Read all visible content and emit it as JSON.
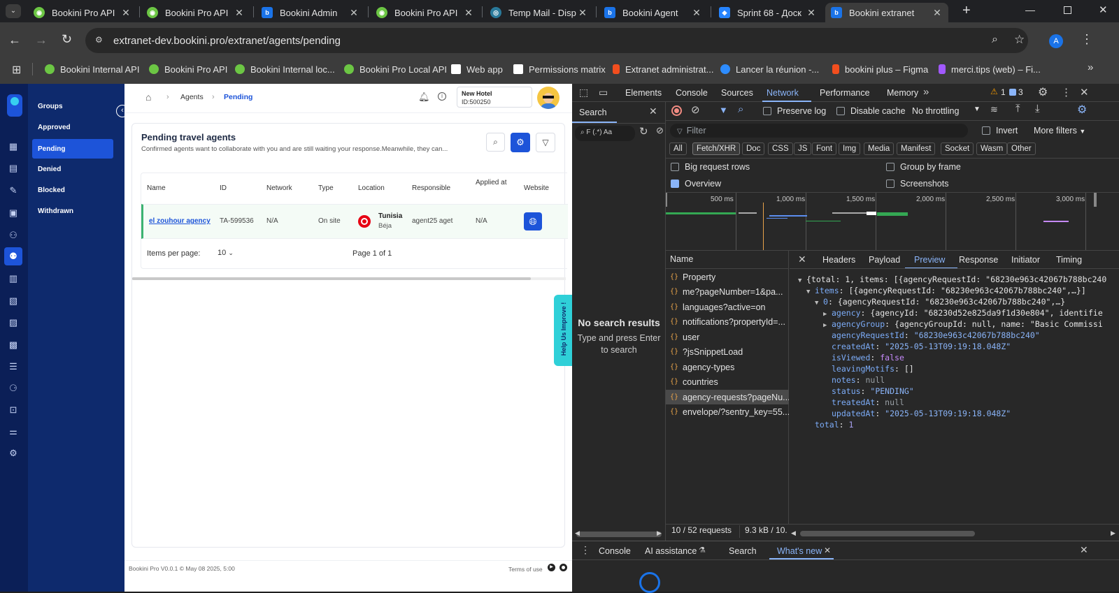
{
  "browser": {
    "tabs": [
      {
        "title": "Bookini Pro API",
        "color": "#6cc644"
      },
      {
        "title": "Bookini Pro API",
        "color": "#6cc644"
      },
      {
        "title": "Bookini Admin",
        "color": "#1a73e8"
      },
      {
        "title": "Bookini Pro API",
        "color": "#6cc644"
      },
      {
        "title": "Temp Mail - Disp",
        "color": "#2a7a9b"
      },
      {
        "title": "Bookini Agent",
        "color": "#1a73e8"
      },
      {
        "title": "Sprint 68 - Доск",
        "color": "#2684ff"
      },
      {
        "title": "Bookini extranet",
        "color": "#1a73e8"
      }
    ],
    "url": "extranet-dev.bookini.pro/extranet/agents/pending",
    "profile_initial": "A",
    "bookmarks": [
      {
        "label": "Bookini Internal API",
        "color": "#6cc644"
      },
      {
        "label": "Bookini Pro API",
        "color": "#6cc644"
      },
      {
        "label": "Bookini Internal loc...",
        "color": "#6cc644"
      },
      {
        "label": "Bookini Pro Local API",
        "color": "#6cc644"
      },
      {
        "label": "Web app",
        "color": "#ffffff"
      },
      {
        "label": "Permissions matrix",
        "color": "#ffffff"
      },
      {
        "label": "Extranet administrat...",
        "color": "#f24e1e"
      },
      {
        "label": "Lancer la réunion -...",
        "color": "#2d8cff"
      },
      {
        "label": "bookini plus – Figma",
        "color": "#f24e1e"
      },
      {
        "label": "merci.tips (web) – Fi...",
        "color": "#a259ff"
      }
    ]
  },
  "sidebar": {
    "items": [
      "Groups",
      "Approved",
      "Pending",
      "Denied",
      "Blocked",
      "Withdrawn"
    ],
    "selected": "Pending"
  },
  "header": {
    "breadcrumb": [
      "Agents",
      "Pending"
    ],
    "hotel_name": "New Hotel",
    "hotel_id": "ID:500250"
  },
  "main": {
    "title": "Pending travel agents",
    "subtitle": "Confirmed agents want to collaborate with you and are still waiting your response.Meanwhile, they can...",
    "columns": [
      "Name",
      "ID",
      "Network",
      "Type",
      "Location",
      "Responsible",
      "Applied at",
      "Website"
    ],
    "rows": [
      {
        "name": "el zouhour agency",
        "id": "TA-599536",
        "network": "N/A",
        "type": "On site",
        "country": "Tunisia",
        "city": "Béja",
        "responsible": "agent25 aget",
        "applied_at": "N/A"
      }
    ],
    "items_per_page_label": "Items per page:",
    "items_per_page": "10",
    "page_info": "Page 1 of 1",
    "help_tab": "Help Us Improve !",
    "footer_version": "Bookini Pro V0.0.1 © May 08 2025, 5:00",
    "footer_terms": "Terms of use"
  },
  "devtools": {
    "tabs": [
      "Elements",
      "Console",
      "Sources",
      "Network",
      "Performance",
      "Memory"
    ],
    "active_tab": "Network",
    "warnings": "1",
    "issues": "3",
    "search_panel_title": "Search",
    "search_no_results": "No search results",
    "search_hint": "Type and press Enter to search",
    "preserve_log": "Preserve log",
    "disable_cache": "Disable cache",
    "throttling": "No throttling",
    "filter_placeholder": "Filter",
    "invert": "Invert",
    "more_filters": "More filters",
    "type_chips": [
      "All",
      "Fetch/XHR",
      "Doc",
      "CSS",
      "JS",
      "Font",
      "Img",
      "Media",
      "Manifest",
      "Socket",
      "Wasm",
      "Other"
    ],
    "active_chip": "Fetch/XHR",
    "opt_big_rows": "Big request rows",
    "opt_group_frame": "Group by frame",
    "opt_overview": "Overview",
    "opt_screenshots": "Screenshots",
    "timeline_ticks": [
      "500 ms",
      "1,000 ms",
      "1,500 ms",
      "2,000 ms",
      "2,500 ms",
      "3,000 ms"
    ],
    "name_header": "Name",
    "requests": [
      "Property",
      "me?pageNumber=1&pa...",
      "languages?active=on",
      "notifications?propertyId=...",
      "user",
      "?jsSnippetLoad",
      "agency-types",
      "countries",
      "agency-requests?pageNu...",
      "envelope/?sentry_key=55..."
    ],
    "selected_request": "agency-requests?pageNu...",
    "status_requests": "10 / 52 requests",
    "status_size": "9.3 kB / 10.",
    "detail_tabs": [
      "Headers",
      "Payload",
      "Preview",
      "Response",
      "Initiator",
      "Timing"
    ],
    "active_detail_tab": "Preview",
    "preview": {
      "root": "{total: 1, items: [{agencyRequestId: \"68230e963c42067b788bc240",
      "items_line": "[{agencyRequestId: \"68230e963c42067b788bc240\",…}]",
      "item0_line": "{agencyRequestId: \"68230e963c42067b788bc240\",…}",
      "agency": "{agencyId: \"68230d52e825da9f1d30e804\", identifie",
      "agencyGroup": "{agencyGroupId: null, name: \"Basic Commissi",
      "agencyRequestId": "\"68230e963c42067b788bc240\"",
      "createdAt": "\"2025-05-13T09:19:18.048Z\"",
      "isViewed": "false",
      "leavingMotifs": "[]",
      "notes": "null",
      "status": "\"PENDING\"",
      "treatedAt": "null",
      "updatedAt": "\"2025-05-13T09:19:18.048Z\"",
      "total": "1"
    },
    "drawer_tabs": [
      "Console",
      "AI assistance",
      "Search",
      "What's new"
    ],
    "active_drawer_tab": "What's new"
  }
}
